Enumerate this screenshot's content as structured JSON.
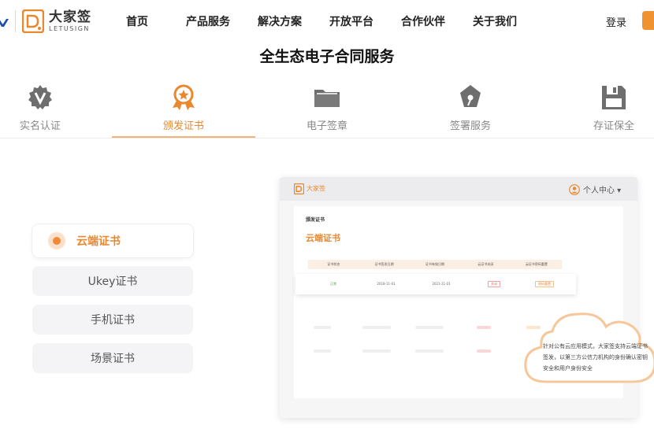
{
  "header": {
    "logo_cn": "大家签",
    "logo_en": "LETUSIGN",
    "nav": [
      "首页",
      "产品服务",
      "解决方案",
      "开放平台",
      "合作伙伴",
      "关于我们"
    ],
    "login": "登录"
  },
  "page_title": "全生态电子合同服务",
  "tabs": [
    {
      "label": "实名认证",
      "icon": "shield-v-icon"
    },
    {
      "label": "颁发证书",
      "icon": "award-icon",
      "active": true
    },
    {
      "label": "电子签章",
      "icon": "folder-icon"
    },
    {
      "label": "签署服务",
      "icon": "pen-nib-icon"
    },
    {
      "label": "存证保全",
      "icon": "save-disk-icon"
    }
  ],
  "cert_list": [
    {
      "label": "云端证书",
      "active": true
    },
    {
      "label": "Ukey证书"
    },
    {
      "label": "手机证书"
    },
    {
      "label": "场景证书"
    }
  ],
  "mock": {
    "logo_cn": "大家签",
    "logo_en": "LETUSIGN",
    "user": "个人中心 ▾",
    "crumb": "颁发证书",
    "heading": "云端证书",
    "columns": [
      "证书状态",
      "证书签发日期",
      "证书有效日期",
      "云证书关闭",
      "云证书密码重置"
    ],
    "row": {
      "status": "正常",
      "issue_date": "2018-11-01",
      "valid_date": "2021-11-01",
      "close": "关闭",
      "reset": "密码重置"
    }
  },
  "cloud_text": "针对公有云应用模式，大家签支持云端证书签发，以第三方公信力机构的身份确认密钥安全和用户身份安全",
  "colors": {
    "accent": "#e9882f",
    "icon_gray": "#6e6e6e"
  }
}
